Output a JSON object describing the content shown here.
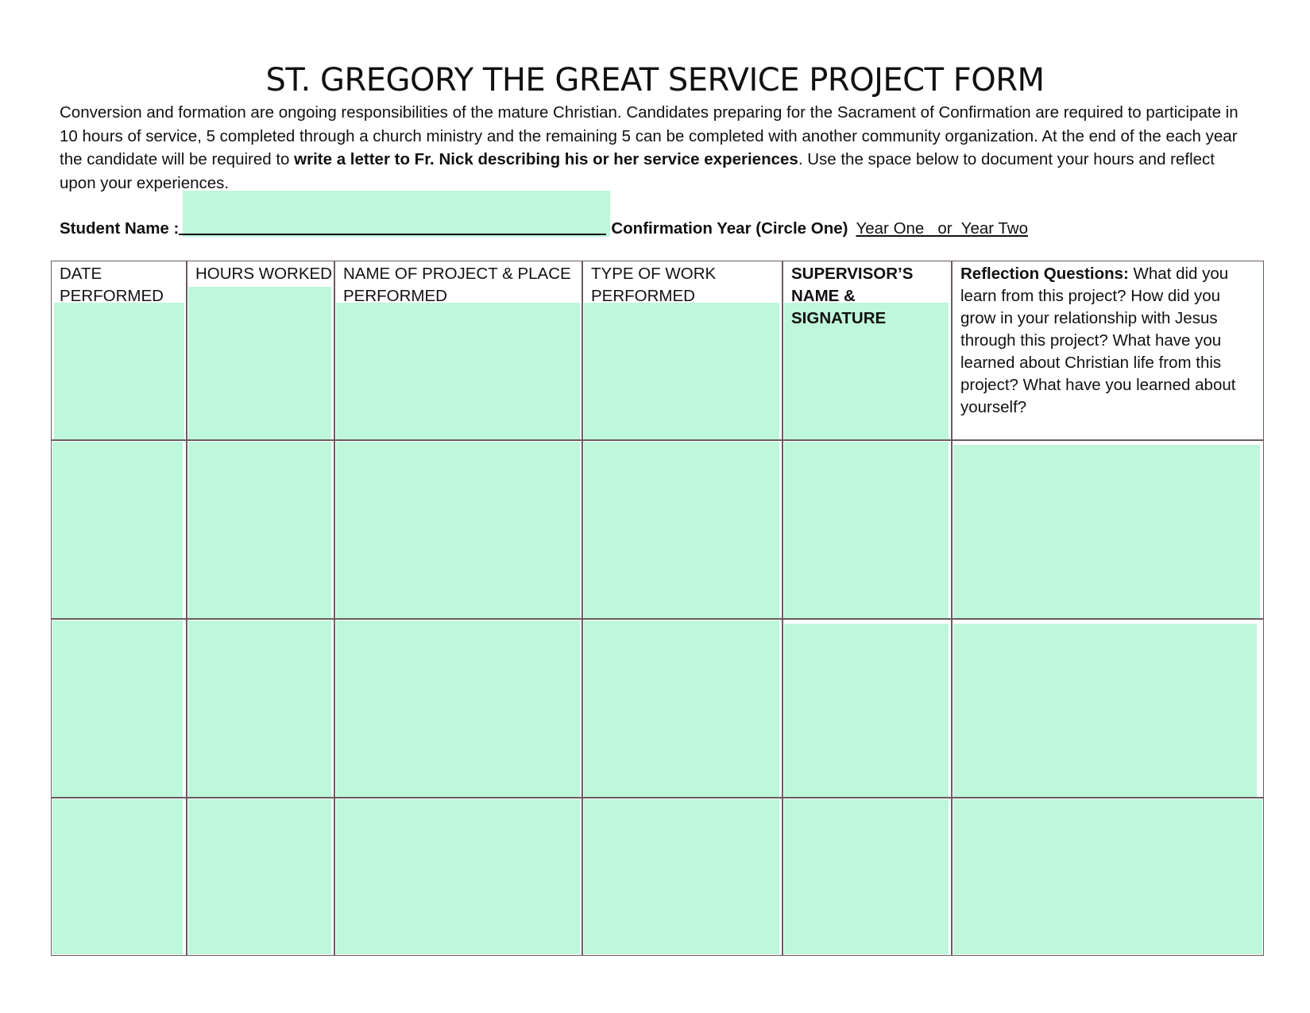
{
  "form": {
    "title": "ST. GREGORY THE GREAT SERVICE PROJECT FORM",
    "intro_part1": "Conversion and formation are ongoing responsibilities of the mature Christian. Candidates preparing for the Sacrament of Confirmation are required to participate in 10 hours of service, 5 completed through a church ministry and the remaining 5 can be completed with another community organization. At the end of the each year the candidate will be required to ",
    "intro_bold": "write a letter to Fr. Nick describing his or her service experiences",
    "intro_part2": ". Use the space below to document your hours and reflect upon your experiences.",
    "student_name_label": "Student Name :",
    "student_name_value": "",
    "confirmation_year_label": "Confirmation Year (Circle One)",
    "year_options": "Year One   or  Year Two"
  },
  "table": {
    "headers": {
      "date": "DATE PERFORMED",
      "hours": "HOURS WORKED",
      "project": "NAME OF PROJECT & PLACE PERFORMED",
      "type": "TYPE OF WORK PERFORMED",
      "supervisor": "SUPERVISOR’S NAME & SIGNATURE",
      "reflection_label": "Reflection Questions:",
      "reflection_text": " What did you learn from this project? How did you grow in your relationship with Jesus through this project? What have you learned about Christian life from this project? What have you learned about yourself?"
    },
    "fill_color": "#bef7db",
    "border_color": "#6b5b5f"
  }
}
